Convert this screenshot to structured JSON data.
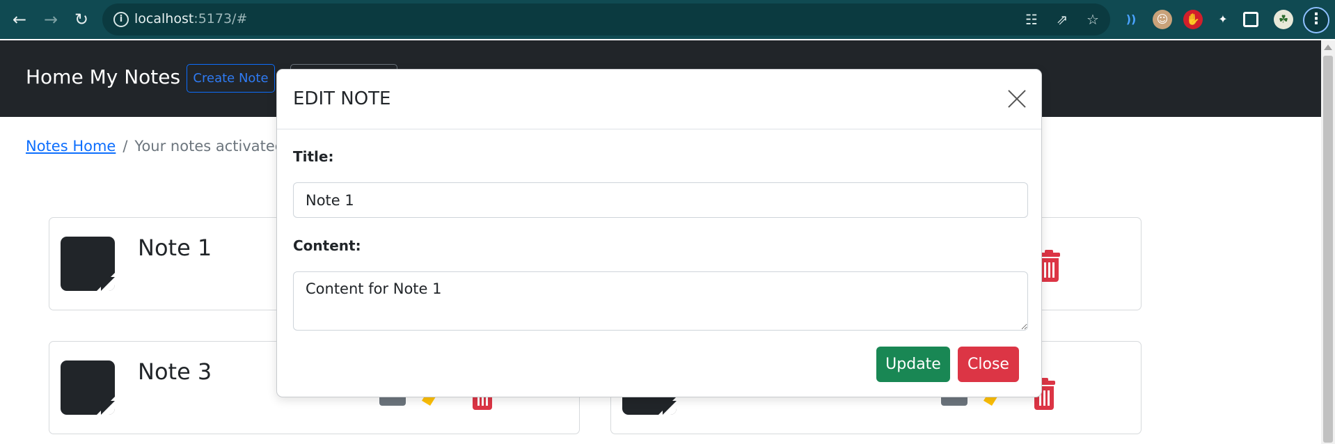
{
  "browser": {
    "url_host": "localhost",
    "url_rest": ":5173/#",
    "back_icon": "arrow-left-icon",
    "forward_icon": "arrow-right-icon",
    "reload_icon": "reload-icon"
  },
  "navbar": {
    "brand": "Home My Notes",
    "create_note_label": "Create Note"
  },
  "breadcrumb": {
    "home_link": "Notes Home",
    "separator": "/",
    "current": "Your notes activated"
  },
  "notes": [
    {
      "title": "Note 1"
    },
    {
      "title": "Note 3"
    }
  ],
  "modal": {
    "title": "EDIT NOTE",
    "title_label": "Title:",
    "title_value": "Note 1",
    "content_label": "Content:",
    "content_value": "Content for Note 1",
    "update_label": "Update",
    "close_label": "Close"
  },
  "colors": {
    "browser_bar": "#104a52",
    "navbar": "#212529",
    "primary": "#0d6efd",
    "success": "#198754",
    "danger": "#dc3545",
    "warning": "#ffc107",
    "secondary": "#6c757d"
  }
}
